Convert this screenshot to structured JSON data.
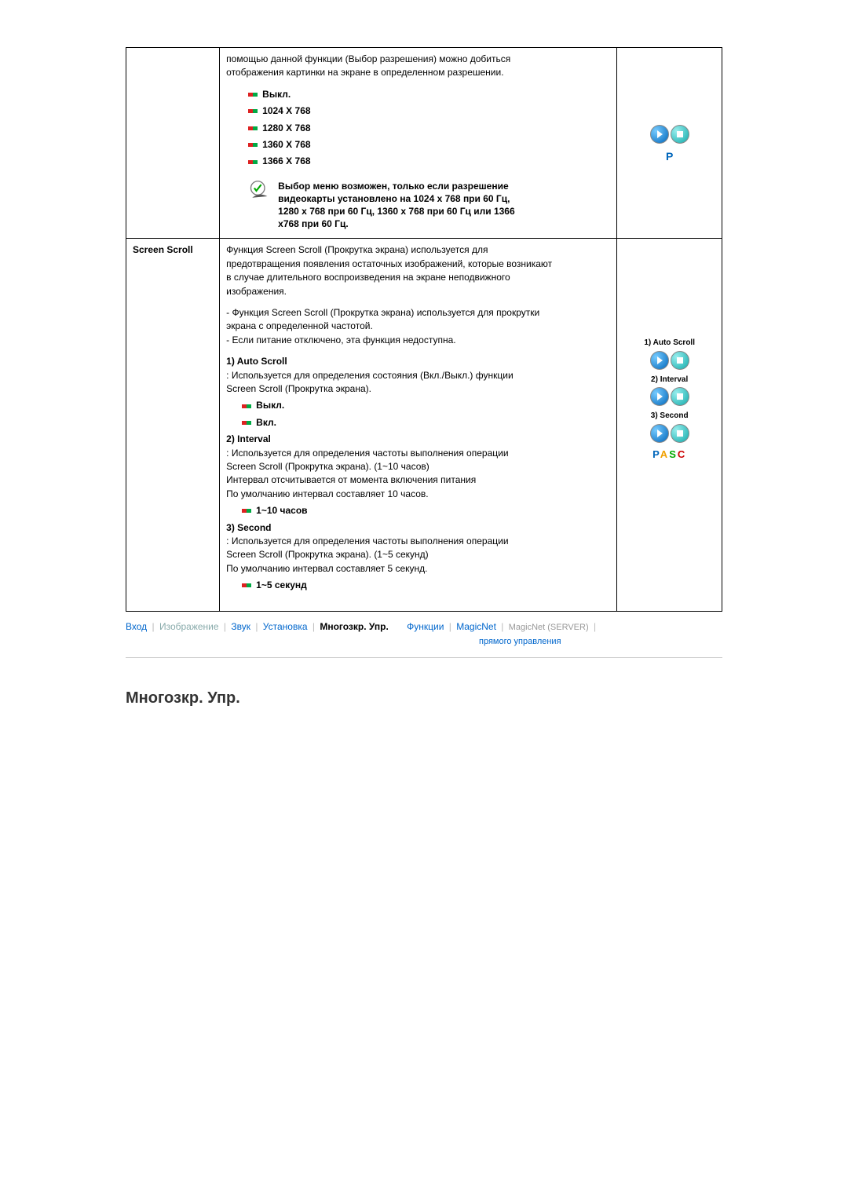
{
  "row1": {
    "label": "",
    "desc_intro_1": "помощью данной функции (Выбор разрешения) можно добиться",
    "desc_intro_2": "отображения картинки на экране в определенном разрешении.",
    "options": [
      "Выкл.",
      "1024 X 768",
      "1280 X 768",
      "1360 X 768",
      "1366 X 768"
    ],
    "note_l1": "Выбор меню возможен, только если разрешение",
    "note_l2": "видеокарты установлено на 1024 x 768 при 60 Гц,",
    "note_l3": "1280 x 768 при 60 Гц, 1360 x 768 при 60 Гц или 1366",
    "note_l4": "x768 при 60 Гц.",
    "side_mode": "P"
  },
  "row2": {
    "label": "Screen Scroll",
    "p1_l1": "Функция Screen Scroll (Прокрутка экрана) используется для",
    "p1_l2": "предотвращения появления остаточных изображений, которые возникают",
    "p1_l3": "в случае длительного воспроизведения на экране неподвижного",
    "p1_l4": "изображения.",
    "p2_l1": "- Функция Screen Scroll (Прокрутка экрана) используется для прокрутки",
    "p2_l2": "экрана с определенной частотой.",
    "p2_l3": "- Если питание отключено, эта функция недоступна.",
    "h1": "1) Auto Scroll",
    "h1_l1": ": Используется для определения состояния (Вкл./Выкл.) функции",
    "h1_l2": "Screen Scroll (Прокрутка экрана).",
    "h1_opts": [
      "Выкл.",
      "Вкл."
    ],
    "h2": "2) Interval",
    "h2_l1": ": Используется для определения частоты выполнения операции",
    "h2_l2": "Screen Scroll (Прокрутка экрана). (1~10 часов)",
    "h2_l3": "Интервал отсчитывается от момента включения питания",
    "h2_l4": "По умолчанию интервал составляет 10 часов.",
    "h2_opt": "1~10 часов",
    "h3": "3) Second",
    "h3_l1": ":  Используется для определения частоты выполнения операции",
    "h3_l2": "Screen Scroll (Прокрутка экрана). (1~5 секунд)",
    "h3_l3": "По умолчанию интервал составляет 5 секунд.",
    "h3_opt": "1~5 секунд",
    "side": {
      "s1": "1) Auto Scroll",
      "s2": "2) Interval",
      "s3": "3) Second"
    }
  },
  "tabs": {
    "t1": "Вход",
    "t2": "Изображение",
    "t3": "Звук",
    "t4": "Установка",
    "t5": "Многозкр. Упр.",
    "t6": "Функции",
    "t6b": "прямого управления",
    "t7": "MagicNet",
    "t8": "MagicNet (SERVER)"
  },
  "section_title": "Многозкр. Упр."
}
